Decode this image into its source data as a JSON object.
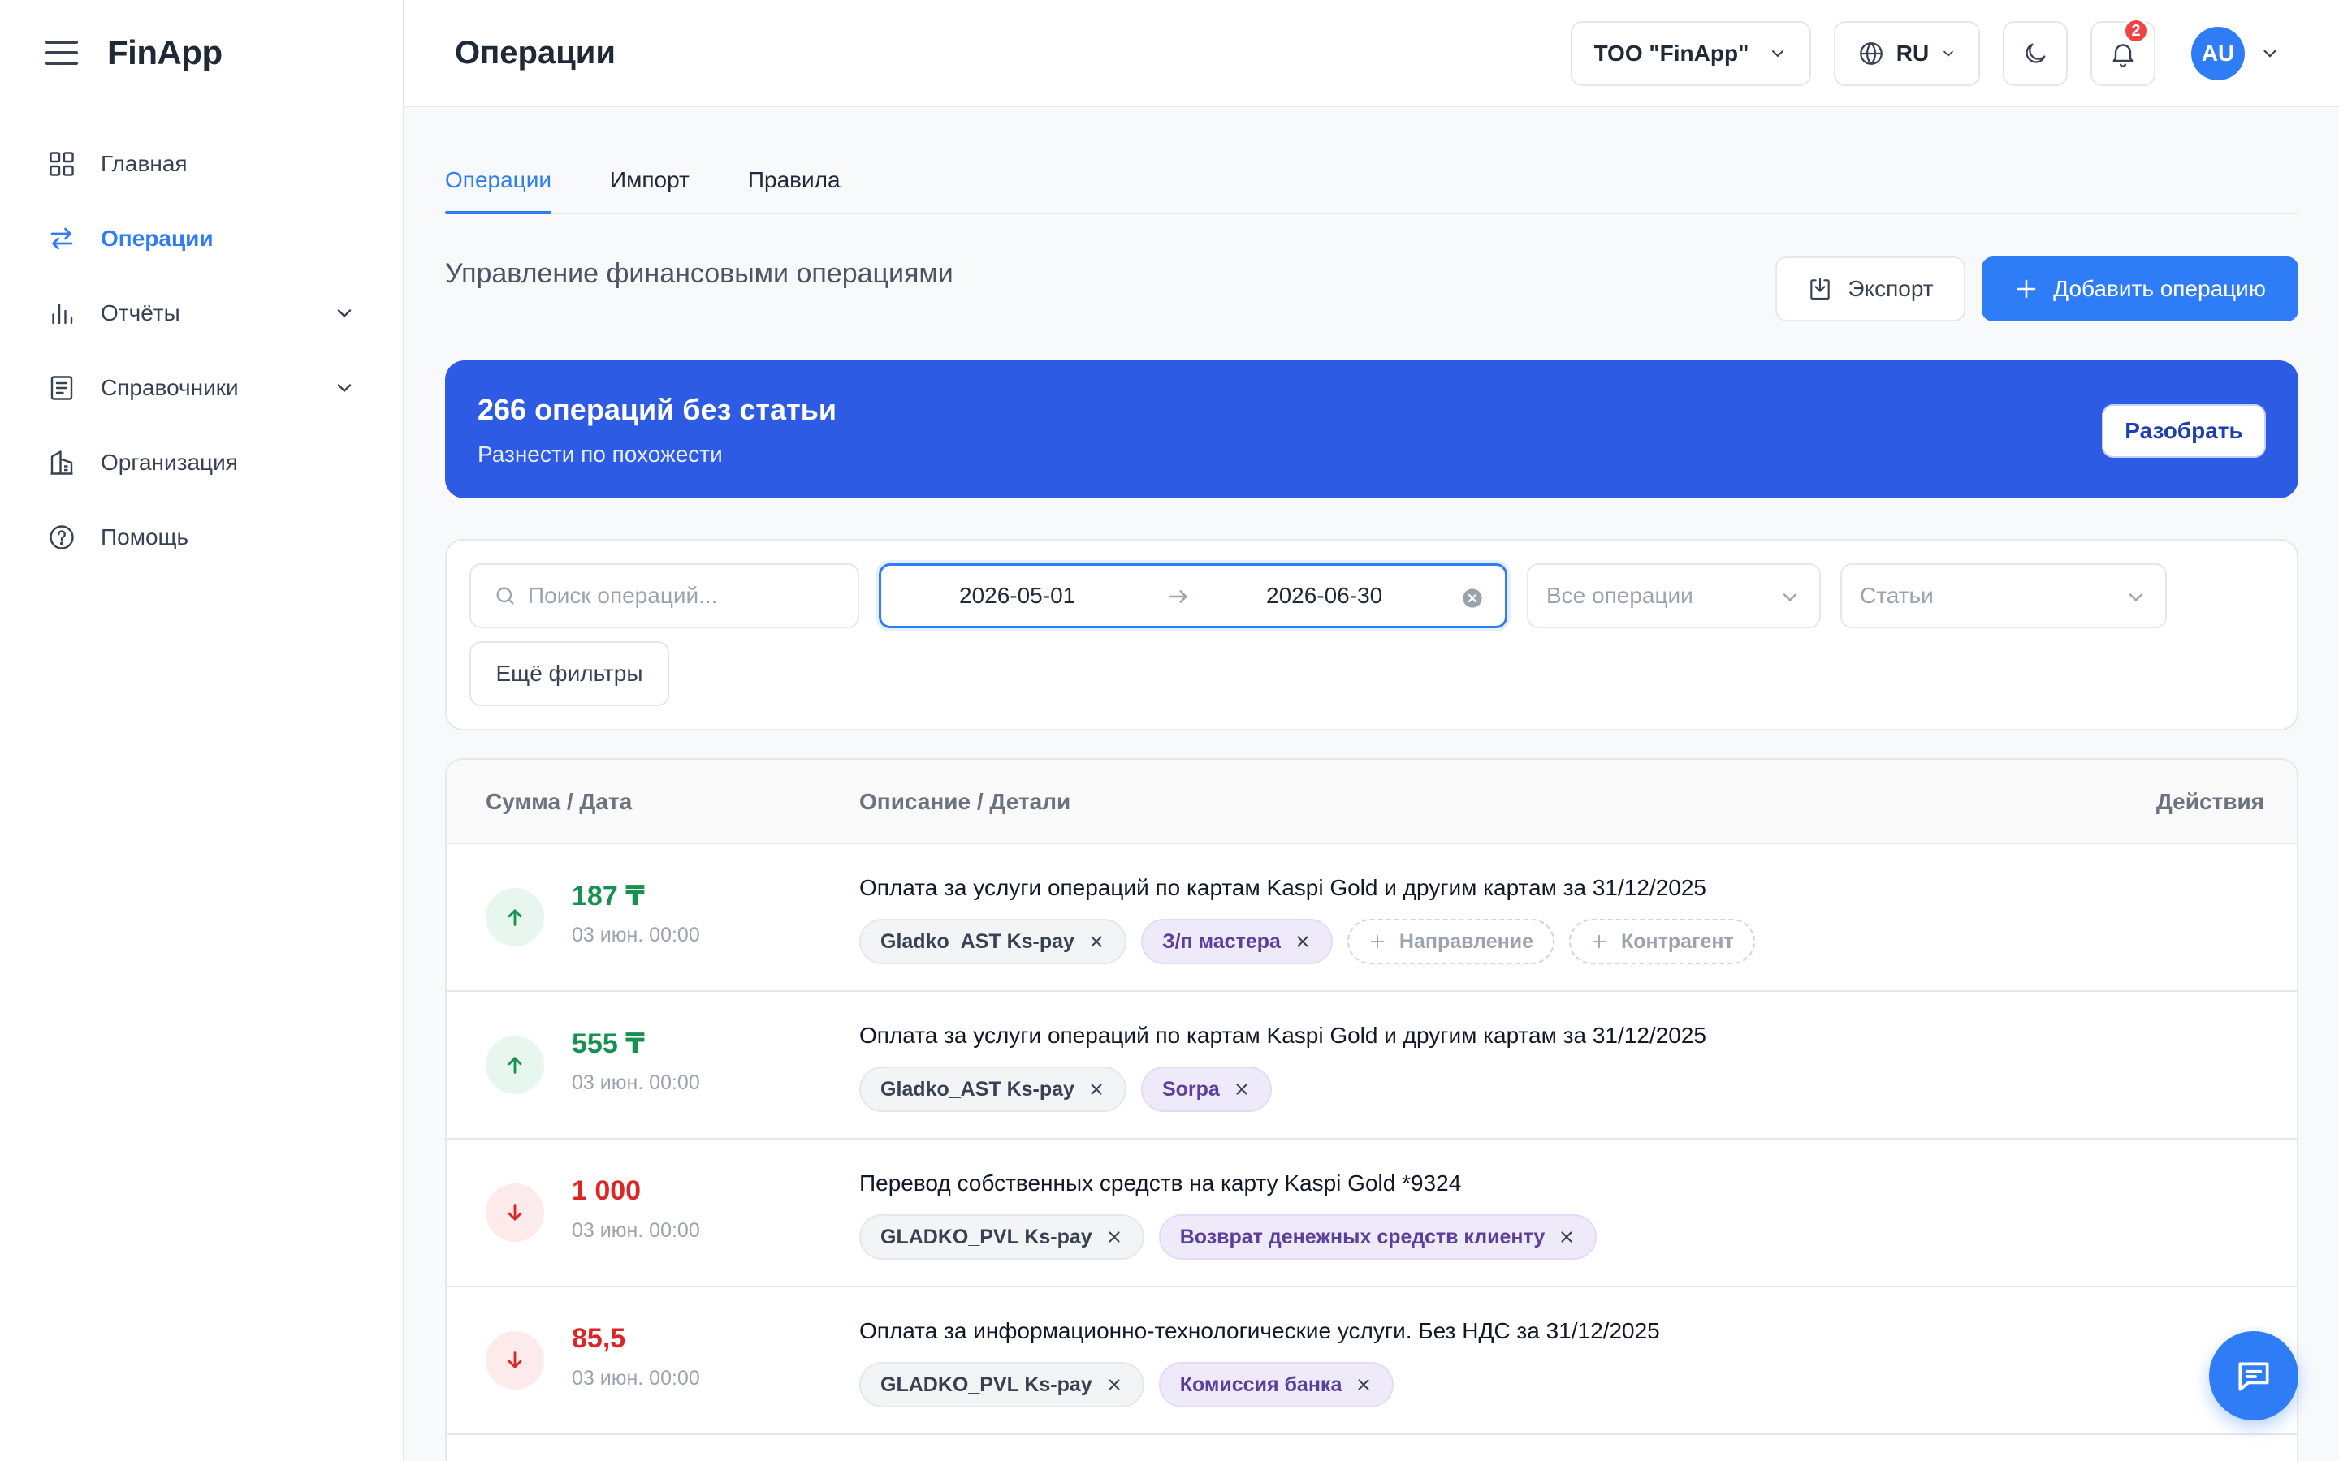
{
  "app": {
    "logo": "FinApp"
  },
  "sidebar": {
    "items": [
      {
        "label": "Главная",
        "icon": "grid-icon"
      },
      {
        "label": "Операции",
        "icon": "swap-icon",
        "active": true
      },
      {
        "label": "Отчёты",
        "icon": "bar-chart-icon",
        "expandable": true
      },
      {
        "label": "Справочники",
        "icon": "book-icon",
        "expandable": true
      },
      {
        "label": "Организация",
        "icon": "building-icon"
      },
      {
        "label": "Помощь",
        "icon": "help-icon"
      }
    ]
  },
  "header": {
    "title": "Операции",
    "org": "ТОО \"FinApp\"",
    "lang": "RU",
    "notifications": "2",
    "avatar": "AU"
  },
  "tabs": [
    {
      "label": "Операции",
      "active": true
    },
    {
      "label": "Импорт"
    },
    {
      "label": "Правила"
    }
  ],
  "toolbar": {
    "subtitle": "Управление финансовыми операциями",
    "export_label": "Экспорт",
    "add_label": "Добавить операцию"
  },
  "banner": {
    "title": "266 операций без статьи",
    "subtitle": "Разнести по похожести",
    "button": "Разобрать"
  },
  "filters": {
    "search_placeholder": "Поиск операций...",
    "date_from": "2026-05-01",
    "date_to": "2026-06-30",
    "type": "Все операции",
    "category": "Статьи",
    "more": "Ещё фильтры"
  },
  "table": {
    "columns": [
      "Сумма / Дата",
      "Описание / Детали",
      "Действия"
    ],
    "rows": [
      {
        "direction": "in",
        "amount": "187 ₸",
        "date": "03 июн. 00:00",
        "description": "Оплата за услуги операций по картам Kaspi Gold и другим картам за 31/12/2025",
        "tags": [
          {
            "label": "Gladko_AST Ks-pay",
            "style": "gray"
          },
          {
            "label": "З/п мастера",
            "style": "purple"
          },
          {
            "label": "Направление",
            "style": "add"
          },
          {
            "label": "Контрагент",
            "style": "add"
          }
        ]
      },
      {
        "direction": "in",
        "amount": "555 ₸",
        "date": "03 июн. 00:00",
        "description": "Оплата за услуги операций по картам Kaspi Gold и другим картам за 31/12/2025",
        "tags": [
          {
            "label": "Gladko_AST Ks-pay",
            "style": "gray"
          },
          {
            "label": "Sorpa",
            "style": "purple"
          }
        ]
      },
      {
        "direction": "out",
        "amount": "1 000",
        "date": "03 июн. 00:00",
        "description": "Перевод собственных средств на карту Kaspi Gold *9324",
        "tags": [
          {
            "label": "GLADKO_PVL Ks-pay",
            "style": "gray"
          },
          {
            "label": "Возврат денежных средств клиенту",
            "style": "purple"
          }
        ]
      },
      {
        "direction": "out",
        "amount": "85,5",
        "date": "03 июн. 00:00",
        "description": "Оплата за информационно-технологические услуги. Без НДС за 31/12/2025",
        "tags": [
          {
            "label": "GLADKO_PVL Ks-pay",
            "style": "gray"
          },
          {
            "label": "Комиссия банка",
            "style": "purple"
          }
        ]
      }
    ]
  },
  "colors": {
    "accent": "#2f7df6",
    "banner": "#2d5be3",
    "income": "#16914f",
    "expense": "#dc2626"
  }
}
